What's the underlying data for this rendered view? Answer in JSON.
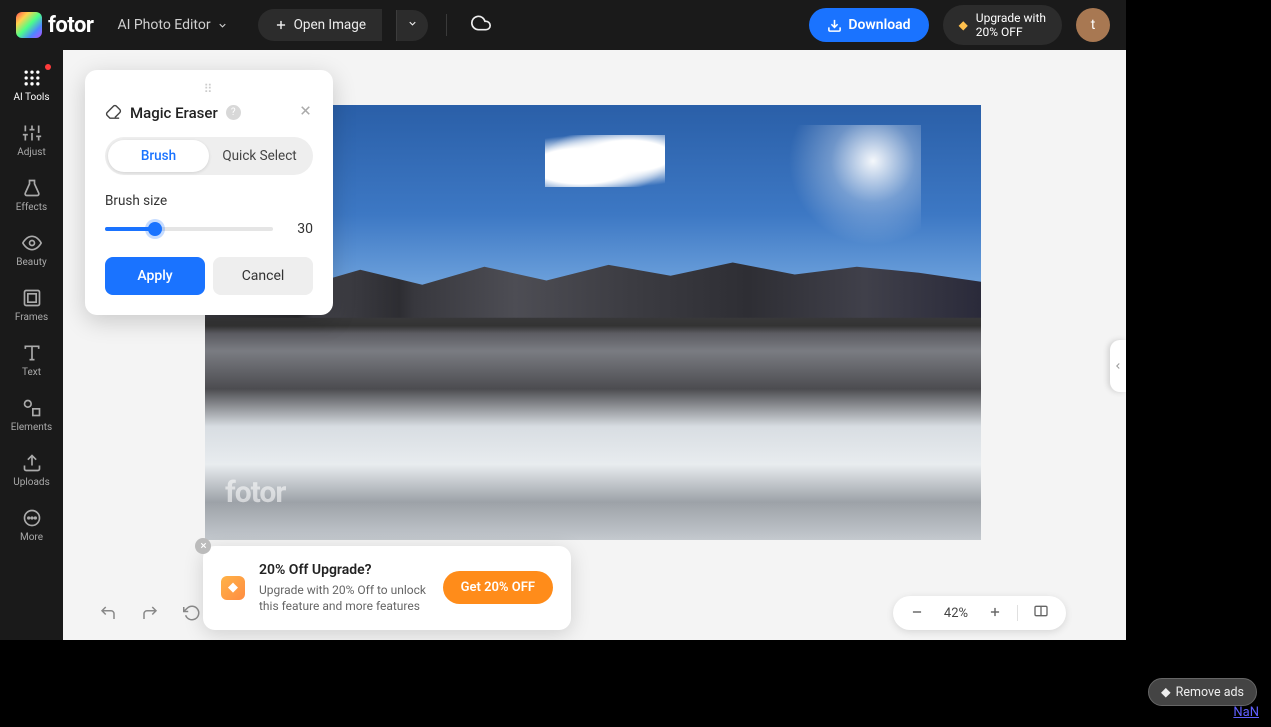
{
  "brand": "fotor",
  "editorLabel": "AI Photo Editor",
  "topbar": {
    "openImage": "Open Image",
    "download": "Download",
    "upgradeLine1": "Upgrade with",
    "upgradeLine2": "20% OFF",
    "avatarLetter": "t"
  },
  "sidebar": {
    "items": [
      {
        "label": "AI Tools"
      },
      {
        "label": "Adjust"
      },
      {
        "label": "Effects"
      },
      {
        "label": "Beauty"
      },
      {
        "label": "Frames"
      },
      {
        "label": "Text"
      },
      {
        "label": "Elements"
      },
      {
        "label": "Uploads"
      },
      {
        "label": "More"
      }
    ]
  },
  "panel": {
    "title": "Magic Eraser",
    "tabs": {
      "brush": "Brush",
      "quick": "Quick Select"
    },
    "brushSizeLabel": "Brush size",
    "brushSizeValue": "30",
    "apply": "Apply",
    "cancel": "Cancel"
  },
  "promo": {
    "title": "20% Off Upgrade?",
    "desc": "Upgrade with 20% Off to unlock this feature and more features",
    "cta": "Get 20% OFF"
  },
  "zoom": {
    "value": "42%"
  },
  "watermark": "fotor",
  "removeAds": "Remove ads",
  "nan": "NaN"
}
